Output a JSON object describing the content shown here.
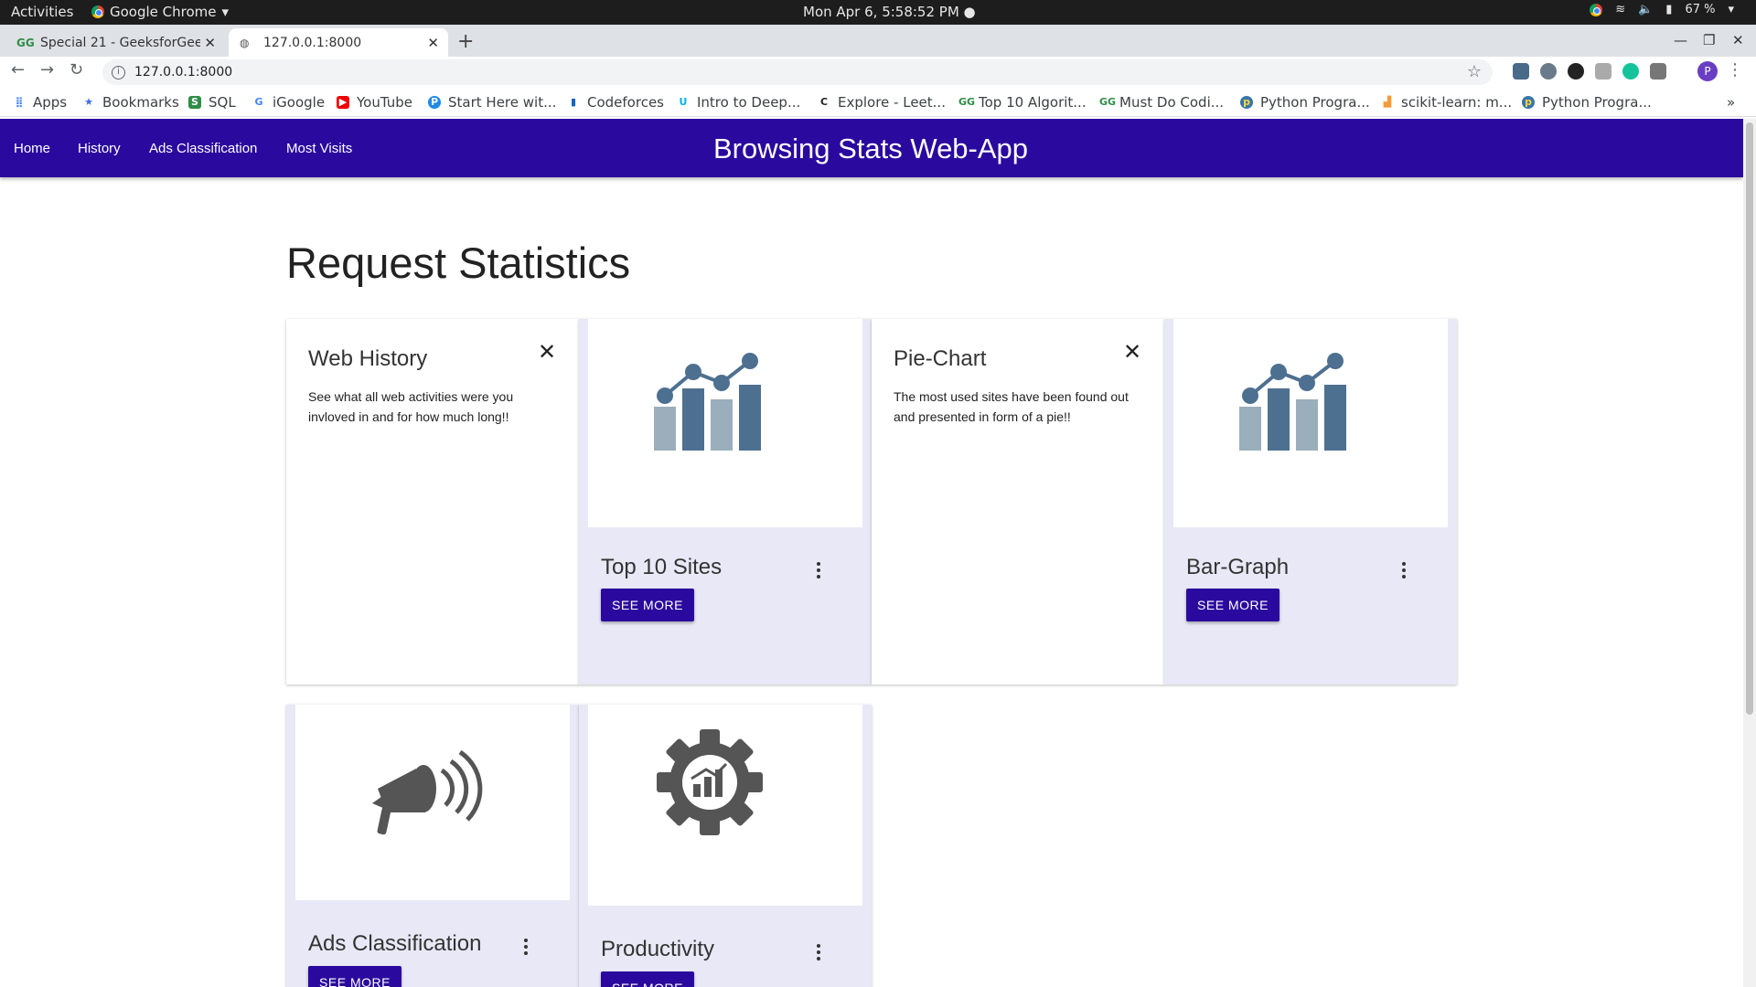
{
  "os_bar": {
    "activities": "Activities",
    "app_name": "Google Chrome",
    "clock": "Mon Apr  6,  5:58:52 PM",
    "battery": "67 %"
  },
  "tabs": [
    {
      "title": "Special 21 - GeeksforGeek",
      "favicon": "gfg-icon"
    },
    {
      "title": "127.0.0.1:8000",
      "favicon": "globe-icon"
    }
  ],
  "toolbar": {
    "url": "127.0.0.1:8000",
    "profile_initial": "P"
  },
  "bookmarks": [
    {
      "label": "Apps",
      "icon": "apps-grid-icon"
    },
    {
      "label": "Bookmarks",
      "icon": "star-icon"
    },
    {
      "label": "SQL",
      "icon": "sql-icon"
    },
    {
      "label": "iGoogle",
      "icon": "google-icon"
    },
    {
      "label": "YouTube",
      "icon": "youtube-icon"
    },
    {
      "label": "Start Here wit...",
      "icon": "blog-icon"
    },
    {
      "label": "Codeforces",
      "icon": "codeforces-icon"
    },
    {
      "label": "Intro to Deep...",
      "icon": "udacity-icon"
    },
    {
      "label": "Explore - Leet...",
      "icon": "leetcode-icon"
    },
    {
      "label": "Top 10 Algorit...",
      "icon": "gfg-icon"
    },
    {
      "label": "Must Do Codi...",
      "icon": "gfg-icon"
    },
    {
      "label": "Python Progra...",
      "icon": "python-icon"
    },
    {
      "label": "scikit-learn: m...",
      "icon": "chart-icon"
    },
    {
      "label": "Python Progra...",
      "icon": "python-icon"
    }
  ],
  "app_nav": {
    "links": [
      "Home",
      "History",
      "Ads Classification",
      "Most Visits"
    ],
    "brand": "Browsing Stats Web-App"
  },
  "page": {
    "title": "Request Statistics"
  },
  "cards": {
    "web_history": {
      "title": "Web History",
      "description": "See what all web activities were you invloved in and for how much long!!"
    },
    "top_sites": {
      "title": "Top 10 Sites",
      "button": "SEE MORE"
    },
    "pie_chart": {
      "title": "Pie-Chart",
      "description": "The most used sites have been found out and presented in form of a pie!!"
    },
    "bar_graph": {
      "title": "Bar-Graph",
      "button": "SEE MORE"
    },
    "ads": {
      "title": "Ads Classification",
      "button": "SEE MORE"
    },
    "productivity": {
      "title": "Productivity",
      "button": "SEE MORE"
    }
  },
  "colors": {
    "primary": "#2a0a9e",
    "card_tint": "#e8e8f6",
    "chart_dark": "#4e7090",
    "chart_light": "#9aaebb",
    "icon_gray": "#555555"
  }
}
